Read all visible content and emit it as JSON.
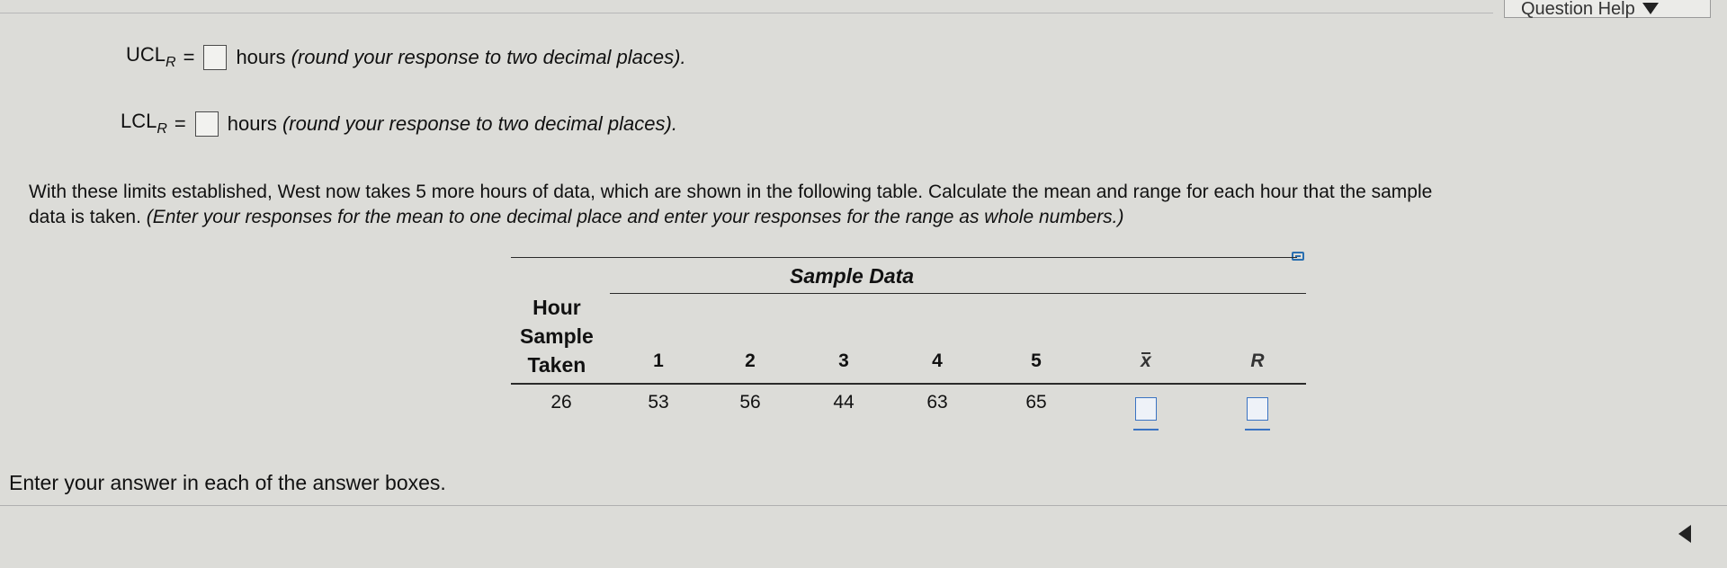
{
  "header": {
    "help_label": "Question Help"
  },
  "limits": {
    "ucl": {
      "label": "UCL",
      "subscript": "R",
      "sign": "=",
      "text_prefix": "hours ",
      "text_italic": "(round your response to two decimal places)."
    },
    "lcl": {
      "label": "LCL",
      "subscript": "R",
      "sign": "=",
      "text_prefix": "hours ",
      "text_italic": "(round your response to two decimal places)."
    }
  },
  "instructions": {
    "line1": "With these limits established, West now takes 5 more hours of data, which are shown in the following table. Calculate the mean and range for each hour that the sample",
    "line2_plain": "data is taken. ",
    "line2_italic": "(Enter your responses for the mean to one decimal place and enter your responses for the range as whole numbers.)"
  },
  "table": {
    "title": "Sample Data",
    "hour_header_lines": [
      "Hour",
      "Sample",
      "Taken"
    ],
    "columns": [
      "1",
      "2",
      "3",
      "4",
      "5"
    ],
    "xbar_header": "x",
    "range_header": "R",
    "row": {
      "hour": "26",
      "values": [
        "53",
        "56",
        "44",
        "63",
        "65"
      ]
    }
  },
  "footer": {
    "text": "Enter your answer in each of the answer boxes."
  },
  "colors": {
    "background": "#dcdcd8",
    "answer_box_blue": "#3a73c2"
  }
}
